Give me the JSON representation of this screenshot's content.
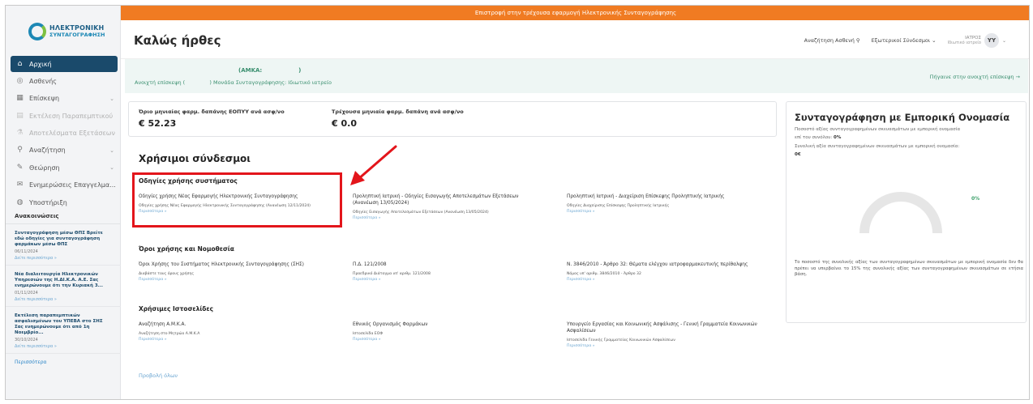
{
  "colors": {
    "banner": "#f07b22",
    "active_nav": "#1a4a6b",
    "link": "#6aa5d1",
    "highlight": "#e3151b",
    "patient_text": "#3a8f6f"
  },
  "logo": {
    "line1": "ΗΛΕΚΤΡΟΝΙΚΗ",
    "line2": "ΣΥΝΤΑΓΟΓΡΑΦΗΣΗ",
    "icon": "logo-mark"
  },
  "banner": {
    "text": "Επιστροφή στην τρέχουσα εφαρμογή Ηλεκτρονικής Συνταγογράφησης"
  },
  "header": {
    "welcome": "Καλώς ήρθες",
    "search_patient": "Αναζήτηση Ασθενή",
    "external_links": "Εξωτερικοί Σύνδεσμοι",
    "user_name": "ΙΑΤΡΟΣ",
    "user_role": "Ιδιωτικό ιατρείο",
    "avatar": "YY"
  },
  "nav": {
    "items": [
      {
        "label": "Αρχική",
        "icon": "home-icon",
        "active": true
      },
      {
        "label": "Ασθενής",
        "icon": "user-circle-icon"
      },
      {
        "label": "Επίσκεψη",
        "icon": "calendar-icon",
        "chevron": true
      },
      {
        "label": "Εκτέλεση Παραπεμπτικού",
        "icon": "document-icon",
        "disabled": true
      },
      {
        "label": "Αποτελέσματα Εξετάσεων",
        "icon": "flask-icon",
        "disabled": true
      },
      {
        "label": "Αναζήτηση",
        "icon": "search-icon",
        "chevron": true
      },
      {
        "label": "Θεώρηση",
        "icon": "pen-icon",
        "chevron": true
      },
      {
        "label": "Ενημερώσεις Επαγγελμα...",
        "icon": "mail-icon"
      },
      {
        "label": "Υποστήριξη",
        "icon": "help-icon"
      }
    ]
  },
  "announcements": {
    "title": "Ανακοινώσεις",
    "items": [
      {
        "title": "Συνταγογράφηση μέσω ΘΠΣ Βρείτε εδώ οδηγίες για συνταγογράφηση φαρμάκων μέσω ΘΠΣ",
        "date": "06/11/2024",
        "more": "Δείτε περισσότερα »"
      },
      {
        "title": "Νέα διαλειτουργία Ηλεκτρονικών Υπηρεσιών της Η.ΔΙ.Κ.Α. Α.Ε. Σας ενημερώνουμε ότι την Κυριακή 3...",
        "date": "01/11/2024",
        "more": "Δείτε περισσότερα »"
      },
      {
        "title": "Εκτέλεση παραπεμπτικών ασφαλισμένων του ΥΠΕΒΑ στο ΣΗΣ Σας ενημερώνουμε ότι από 1η Νοεμβρίο...",
        "date": "30/10/2024",
        "more": "Δείτε περισσότερα »"
      }
    ],
    "all": "Περισσότερα"
  },
  "patient": {
    "amka_label": "(ΑΜΚΑ:",
    "amka_close": ")",
    "open_visit": "Ανοιχτή επίσκεψη (",
    "unit": ") Μονάδα Συνταγογράφησης: Ιδιωτικό ιατρείο",
    "go_open_visit": "Πήγαινε στην ανοιχτή επίσκεψη →"
  },
  "expenses": {
    "limit_label": "Όριο μηνιαίας φαρμ. δαπάνης ΕΟΠΥΥ ανά ασφ/νο",
    "limit_value": "€ 52.23",
    "current_label": "Τρέχουσα μηνιαία φαρμ. δαπάνη ανά ασφ/νο",
    "current_value": "€ 0.0"
  },
  "useful_links": {
    "title": "Χρήσιμοι σύνδεσμοι",
    "sections": [
      {
        "title": "Οδηγίες χρήσης συστήματος",
        "cells": [
          {
            "title": "Οδηγίες χρήσης Νέας Εφαρμογής Ηλεκτρονικής Συνταγογράφησης",
            "sub": "Οδηγίες χρήσης Νέας Εφαρμογής Ηλεκτρονικής Συνταγογράφησης (Ανανέωση 12/11/2024)",
            "more": "Περισσότερα »"
          },
          {
            "title": "Προληπτική Ιατρική - Οδηγίες Εισαγωγής Αποτελεσμάτων Εξετάσεων (Ανανέωση 13/05/2024)",
            "sub": "Οδηγίες Εισαγωγής Αποτελεσμάτων Εξετάσεων (Ανανέωση 13/05/2024)",
            "more": "Περισσότερα »"
          },
          {
            "title": "Προληπτική Ιατρική - Διαχείριση Επίσκεψης Προληπτικής Ιατρικής",
            "sub": "Οδηγίες Διαχείρισης Επίσκεψης Προληπτικής Ιατρικής",
            "more": "Περισσότερα »"
          }
        ]
      },
      {
        "title": "Όροι χρήσης και Νομοθεσία",
        "cells": [
          {
            "title": "Όροι Χρήσης του Συστήματος Ηλεκτρονικής Συνταγογράφησης (ΣΗΣ)",
            "sub": "Διαβάστε τους όρους χρήσης",
            "more": "Περισσότερα »"
          },
          {
            "title": "Π.Δ. 121/2008",
            "sub": "Προεδρικό Διάταγμα υπ' αριθμ. 121/2008",
            "more": "Περισσότερα »"
          },
          {
            "title": "Ν. 3846/2010 - Άρθρο 32: Θέματα ελέγχου ιατροφαρμακευτικής περίθαλψης",
            "sub": "Νόμος υπ' αριθμ. 3846/2010 - Άρθρο 32",
            "more": "Περισσότερα »"
          }
        ]
      },
      {
        "title": "Χρήσιμες Ιστοσελίδες",
        "cells": [
          {
            "title": "Αναζήτηση Α.Μ.Κ.Α.",
            "sub": "Αναζήτηση στο Μητρώο Α.Μ.Κ.Α",
            "more": "Περισσότερα »"
          },
          {
            "title": "Εθνικός Οργανισμός Φαρμάκων",
            "sub": "Ιστοσελίδα ΕΟΦ",
            "more": "Περισσότερα »"
          },
          {
            "title": "Υπουργείο Εργασίας και Κοινωνικής Ασφάλισης - Γενική Γραμματεία Κοινωνικών Ασφαλίσεων",
            "sub": "Ιστοσελίδα Γενικής Γραμματείας Κοινωνικών Ασφαλίσεων",
            "more": "Περισσότερα »"
          }
        ]
      }
    ],
    "view_all": "Προβολή όλων"
  },
  "trade_name": {
    "title": "Συνταγογράφηση με Εμπορική Ονομασία",
    "line1": "Ποσοστό αξίας συνταγογραφημένων σκευασμάτων με εμπορική ονομασία",
    "line2_prefix": "επί του συνόλου:",
    "line2_value": "0%",
    "line3": "Συνολική αξία συνταγογραφημένων σκευασμάτων με εμπορική ονομασία:",
    "line3_value": "0€",
    "gauge_label": "0%",
    "gauge_fraction": 0,
    "note": "Το ποσοστό της συνολικής αξίας των συνταγογραφημένων σκευασμάτων με εμπορική ονομασία δεν θα πρέπει να υπερβαίνει το 15% της συνολικής αξίας των συνταγογραφημένων σκευασμάτων σε ετήσια βάση."
  }
}
